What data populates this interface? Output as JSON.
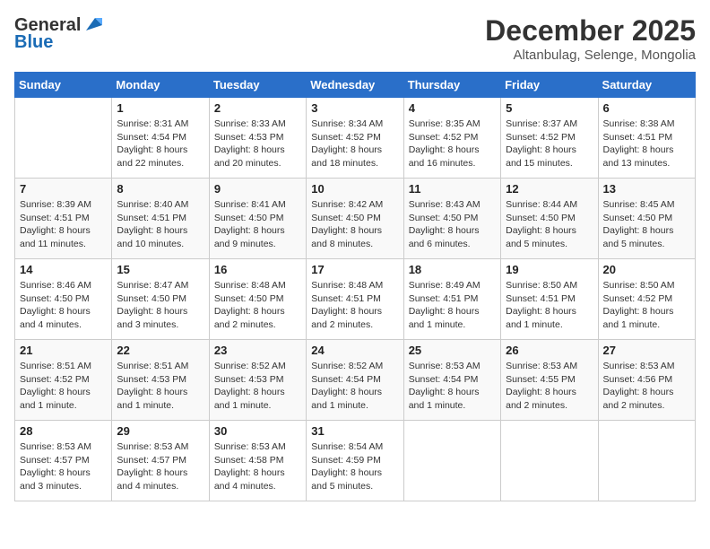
{
  "logo": {
    "general": "General",
    "blue": "Blue"
  },
  "title": {
    "month": "December 2025",
    "location": "Altanbulag, Selenge, Mongolia"
  },
  "days_of_week": [
    "Sunday",
    "Monday",
    "Tuesday",
    "Wednesday",
    "Thursday",
    "Friday",
    "Saturday"
  ],
  "weeks": [
    [
      {
        "day": "",
        "details": ""
      },
      {
        "day": "1",
        "details": "Sunrise: 8:31 AM\nSunset: 4:54 PM\nDaylight: 8 hours\nand 22 minutes."
      },
      {
        "day": "2",
        "details": "Sunrise: 8:33 AM\nSunset: 4:53 PM\nDaylight: 8 hours\nand 20 minutes."
      },
      {
        "day": "3",
        "details": "Sunrise: 8:34 AM\nSunset: 4:52 PM\nDaylight: 8 hours\nand 18 minutes."
      },
      {
        "day": "4",
        "details": "Sunrise: 8:35 AM\nSunset: 4:52 PM\nDaylight: 8 hours\nand 16 minutes."
      },
      {
        "day": "5",
        "details": "Sunrise: 8:37 AM\nSunset: 4:52 PM\nDaylight: 8 hours\nand 15 minutes."
      },
      {
        "day": "6",
        "details": "Sunrise: 8:38 AM\nSunset: 4:51 PM\nDaylight: 8 hours\nand 13 minutes."
      }
    ],
    [
      {
        "day": "7",
        "details": "Sunrise: 8:39 AM\nSunset: 4:51 PM\nDaylight: 8 hours\nand 11 minutes."
      },
      {
        "day": "8",
        "details": "Sunrise: 8:40 AM\nSunset: 4:51 PM\nDaylight: 8 hours\nand 10 minutes."
      },
      {
        "day": "9",
        "details": "Sunrise: 8:41 AM\nSunset: 4:50 PM\nDaylight: 8 hours\nand 9 minutes."
      },
      {
        "day": "10",
        "details": "Sunrise: 8:42 AM\nSunset: 4:50 PM\nDaylight: 8 hours\nand 8 minutes."
      },
      {
        "day": "11",
        "details": "Sunrise: 8:43 AM\nSunset: 4:50 PM\nDaylight: 8 hours\nand 6 minutes."
      },
      {
        "day": "12",
        "details": "Sunrise: 8:44 AM\nSunset: 4:50 PM\nDaylight: 8 hours\nand 5 minutes."
      },
      {
        "day": "13",
        "details": "Sunrise: 8:45 AM\nSunset: 4:50 PM\nDaylight: 8 hours\nand 5 minutes."
      }
    ],
    [
      {
        "day": "14",
        "details": "Sunrise: 8:46 AM\nSunset: 4:50 PM\nDaylight: 8 hours\nand 4 minutes."
      },
      {
        "day": "15",
        "details": "Sunrise: 8:47 AM\nSunset: 4:50 PM\nDaylight: 8 hours\nand 3 minutes."
      },
      {
        "day": "16",
        "details": "Sunrise: 8:48 AM\nSunset: 4:50 PM\nDaylight: 8 hours\nand 2 minutes."
      },
      {
        "day": "17",
        "details": "Sunrise: 8:48 AM\nSunset: 4:51 PM\nDaylight: 8 hours\nand 2 minutes."
      },
      {
        "day": "18",
        "details": "Sunrise: 8:49 AM\nSunset: 4:51 PM\nDaylight: 8 hours\nand 1 minute."
      },
      {
        "day": "19",
        "details": "Sunrise: 8:50 AM\nSunset: 4:51 PM\nDaylight: 8 hours\nand 1 minute."
      },
      {
        "day": "20",
        "details": "Sunrise: 8:50 AM\nSunset: 4:52 PM\nDaylight: 8 hours\nand 1 minute."
      }
    ],
    [
      {
        "day": "21",
        "details": "Sunrise: 8:51 AM\nSunset: 4:52 PM\nDaylight: 8 hours\nand 1 minute."
      },
      {
        "day": "22",
        "details": "Sunrise: 8:51 AM\nSunset: 4:53 PM\nDaylight: 8 hours\nand 1 minute."
      },
      {
        "day": "23",
        "details": "Sunrise: 8:52 AM\nSunset: 4:53 PM\nDaylight: 8 hours\nand 1 minute."
      },
      {
        "day": "24",
        "details": "Sunrise: 8:52 AM\nSunset: 4:54 PM\nDaylight: 8 hours\nand 1 minute."
      },
      {
        "day": "25",
        "details": "Sunrise: 8:53 AM\nSunset: 4:54 PM\nDaylight: 8 hours\nand 1 minute."
      },
      {
        "day": "26",
        "details": "Sunrise: 8:53 AM\nSunset: 4:55 PM\nDaylight: 8 hours\nand 2 minutes."
      },
      {
        "day": "27",
        "details": "Sunrise: 8:53 AM\nSunset: 4:56 PM\nDaylight: 8 hours\nand 2 minutes."
      }
    ],
    [
      {
        "day": "28",
        "details": "Sunrise: 8:53 AM\nSunset: 4:57 PM\nDaylight: 8 hours\nand 3 minutes."
      },
      {
        "day": "29",
        "details": "Sunrise: 8:53 AM\nSunset: 4:57 PM\nDaylight: 8 hours\nand 4 minutes."
      },
      {
        "day": "30",
        "details": "Sunrise: 8:53 AM\nSunset: 4:58 PM\nDaylight: 8 hours\nand 4 minutes."
      },
      {
        "day": "31",
        "details": "Sunrise: 8:54 AM\nSunset: 4:59 PM\nDaylight: 8 hours\nand 5 minutes."
      },
      {
        "day": "",
        "details": ""
      },
      {
        "day": "",
        "details": ""
      },
      {
        "day": "",
        "details": ""
      }
    ]
  ]
}
